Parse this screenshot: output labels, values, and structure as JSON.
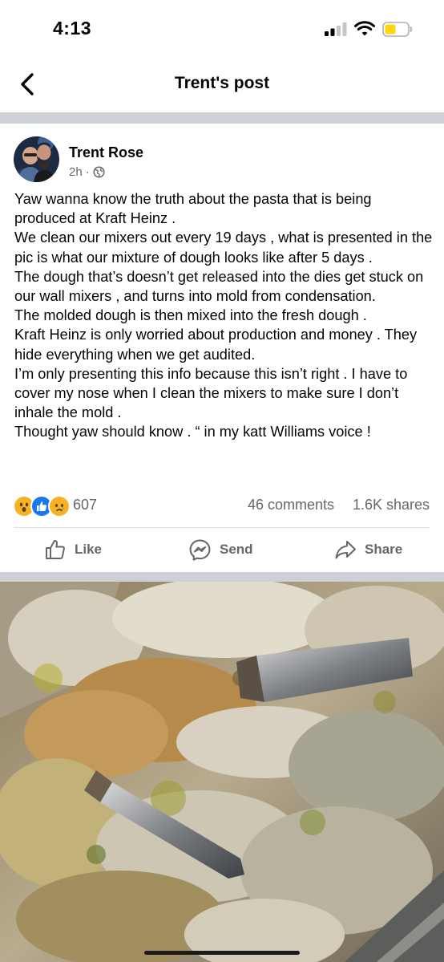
{
  "status_bar": {
    "time": "4:13"
  },
  "nav": {
    "title": "Trent's post"
  },
  "post": {
    "author": "Trent Rose",
    "time": "2h",
    "text": "Yaw wanna know the truth about the pasta that is being produced at Kraft Heinz .\nWe clean our mixers out  every 19 days , what  is presented in the pic is what our mixture of dough looks like after 5 days .\nThe dough that’s doesn’t get released into the dies get stuck on our wall mixers , and turns into mold from condensation.\nThe molded dough is then mixed into the fresh dough .\nKraft Heinz is only worried about production and money . They hide everything when we get audited.\nI’m only presenting this info because this isn’t right . I have to cover my nose when I clean the mixers  to make sure I don’t inhale the mold  .\nThought yaw should know . “ in my katt Williams voice !"
  },
  "stats": {
    "reactions": [
      "wow",
      "like",
      "sad"
    ],
    "reaction_count": "607",
    "comments": "46 comments",
    "shares": "1.6K shares"
  },
  "actions": {
    "like": "Like",
    "send": "Send",
    "share": "Share"
  },
  "icons": [
    "back-icon",
    "globe-icon",
    "like-icon",
    "messenger-icon",
    "share-icon"
  ],
  "colors": {
    "accent": "#1877f2",
    "secondary_text": "#65676b",
    "separator": "#cdd0d4",
    "battery": "#ffd60a"
  }
}
